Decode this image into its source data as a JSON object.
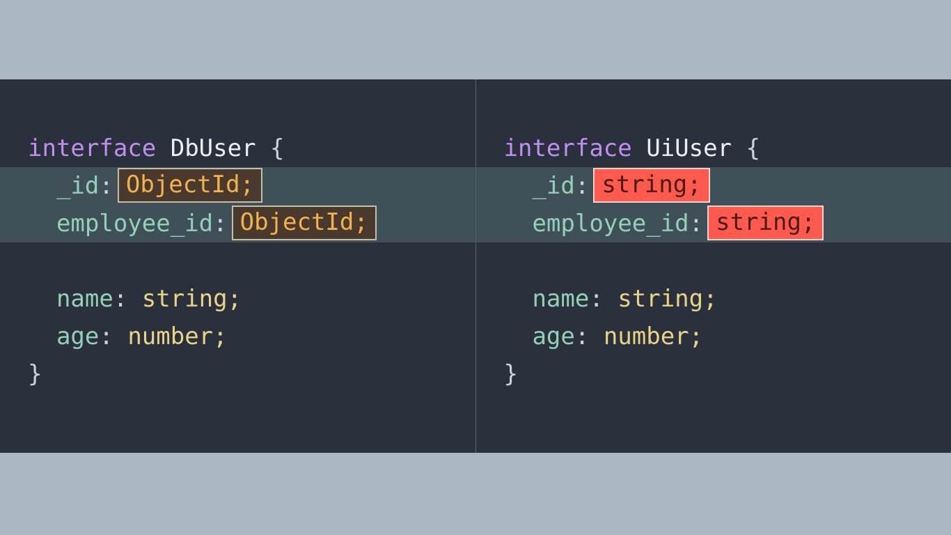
{
  "left": {
    "keyword": "interface",
    "name": "DbUser",
    "openBrace": "{",
    "closeBrace": "}",
    "lines": [
      {
        "key": "_id",
        "type": "ObjectId;",
        "chip": "brown",
        "hl": true
      },
      {
        "key": "employee_id",
        "type": "ObjectId;",
        "chip": "brown",
        "hl": true
      },
      {
        "blank": true
      },
      {
        "key": "name",
        "type": "string;",
        "chip": null
      },
      {
        "key": "age",
        "type": "number;",
        "chip": null
      }
    ]
  },
  "right": {
    "keyword": "interface",
    "name": "UiUser",
    "openBrace": "{",
    "closeBrace": "}",
    "lines": [
      {
        "key": "_id",
        "type": "string;",
        "chip": "red",
        "hl": true
      },
      {
        "key": "employee_id",
        "type": "string;",
        "chip": "red",
        "hl": true
      },
      {
        "blank": true
      },
      {
        "key": "name",
        "type": "string;",
        "chip": null
      },
      {
        "key": "age",
        "type": "number;",
        "chip": null
      }
    ]
  },
  "punct": {
    "colon": ":",
    "space": " "
  }
}
